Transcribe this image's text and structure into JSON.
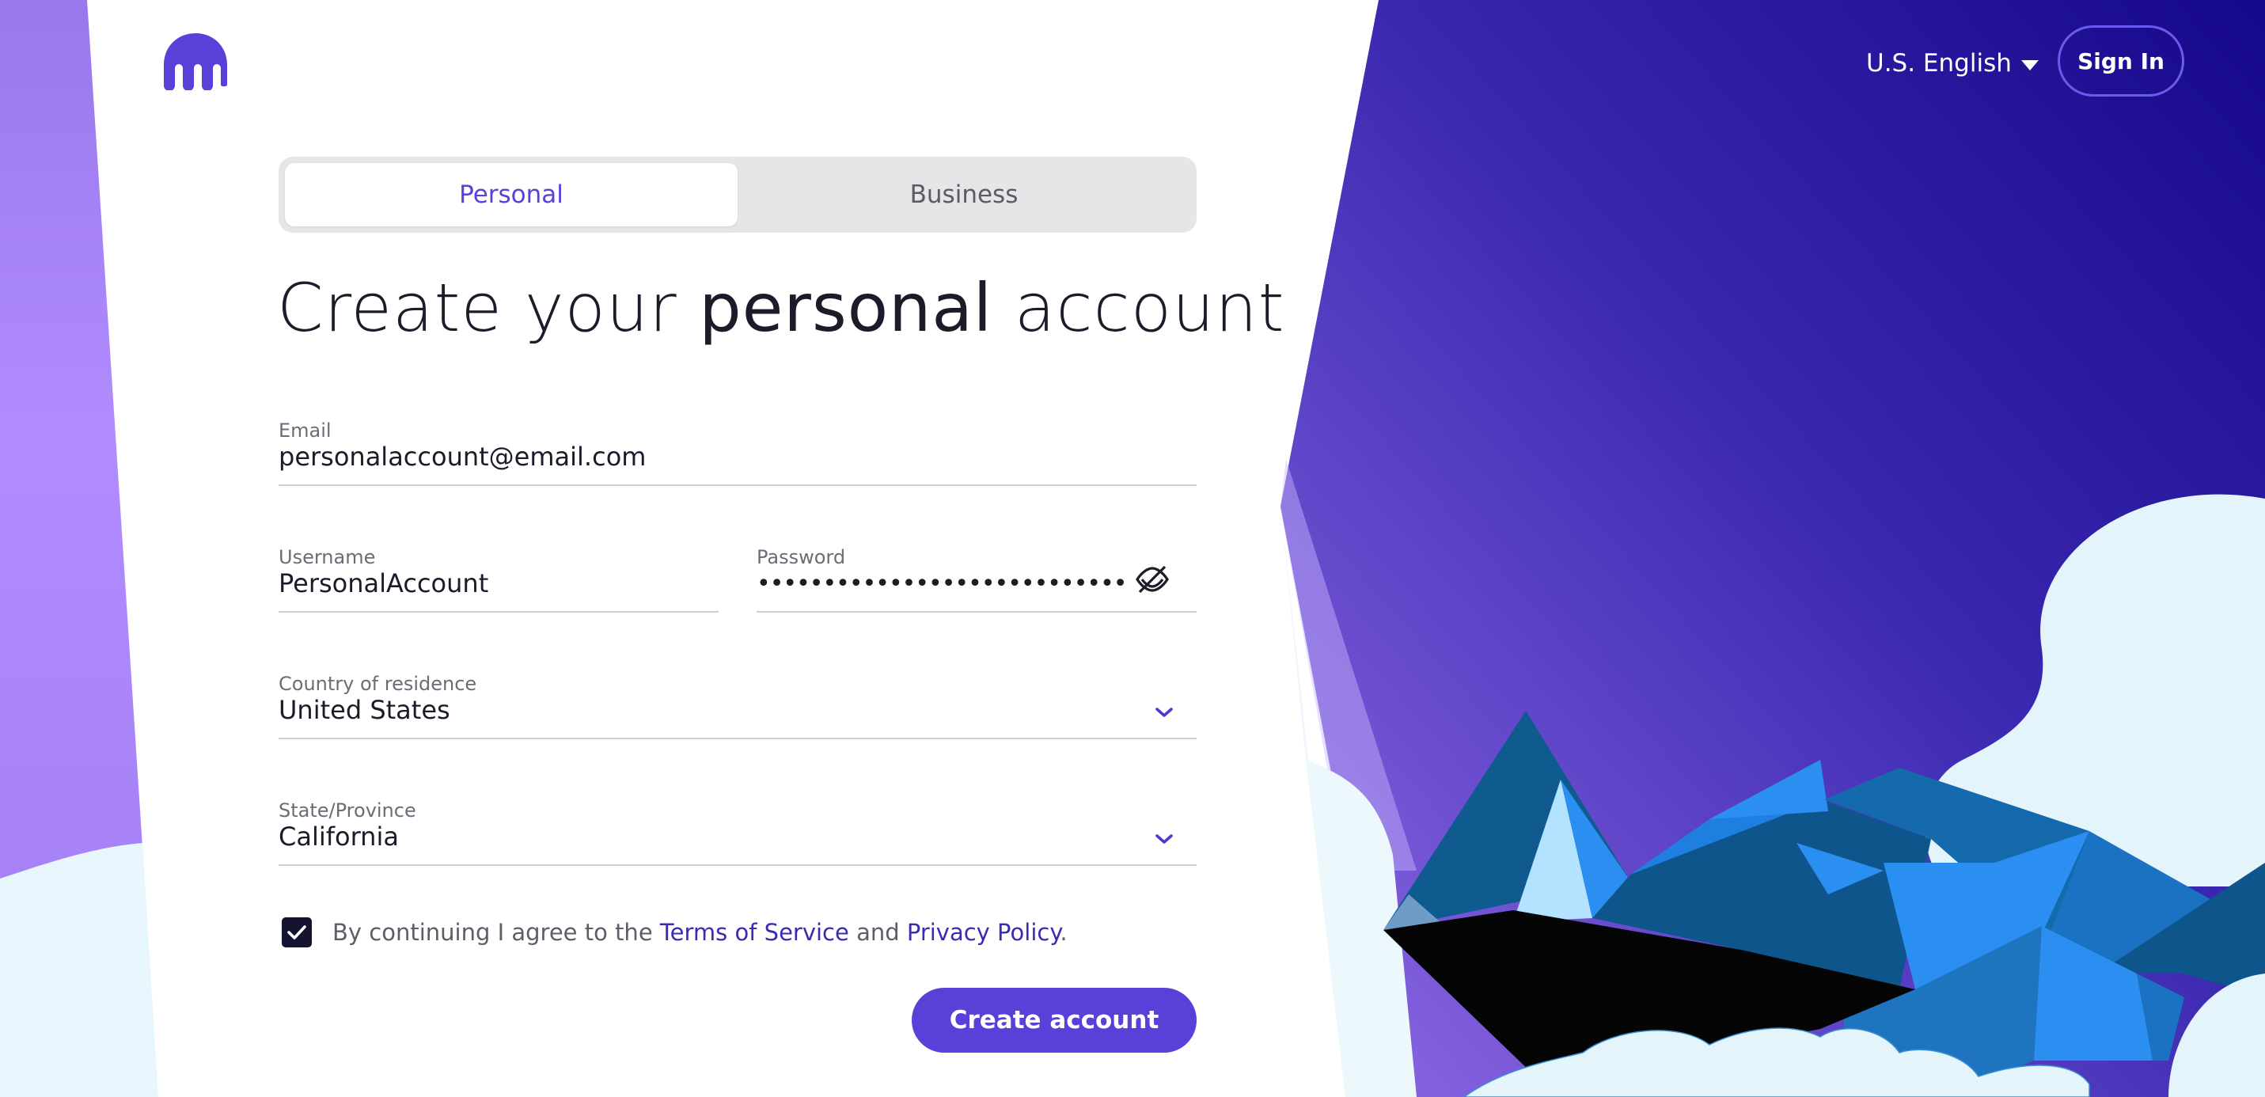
{
  "header": {
    "logo": "kraken-logo",
    "language": "U.S. English",
    "sign_in": "Sign In"
  },
  "tabs": [
    {
      "label": "Personal",
      "active": true
    },
    {
      "label": "Business",
      "active": false
    }
  ],
  "title": {
    "prefix": "Create your",
    "emphasis": "personal",
    "suffix": "account"
  },
  "form": {
    "email": {
      "label": "Email",
      "value": "personalaccount@email.com"
    },
    "username": {
      "label": "Username",
      "value": "PersonalAccount"
    },
    "password": {
      "label": "Password",
      "value": "••••••••••••••••••••••••••••",
      "toggle_icon": "eye-off-icon"
    },
    "country": {
      "label": "Country of residence",
      "value": "United States"
    },
    "state": {
      "label": "State/Province",
      "value": "California"
    }
  },
  "agreement": {
    "checked": true,
    "text_before": "By continuing I agree to the",
    "terms": "Terms of Service",
    "and": "and",
    "privacy": "Privacy Policy",
    "period": "."
  },
  "create_button": "Create account",
  "colors": {
    "accent": "#5741d9",
    "link": "#3a2bb3",
    "hero_dark": "#1a0a8a",
    "mountain_blue": "#2a8ff0"
  }
}
